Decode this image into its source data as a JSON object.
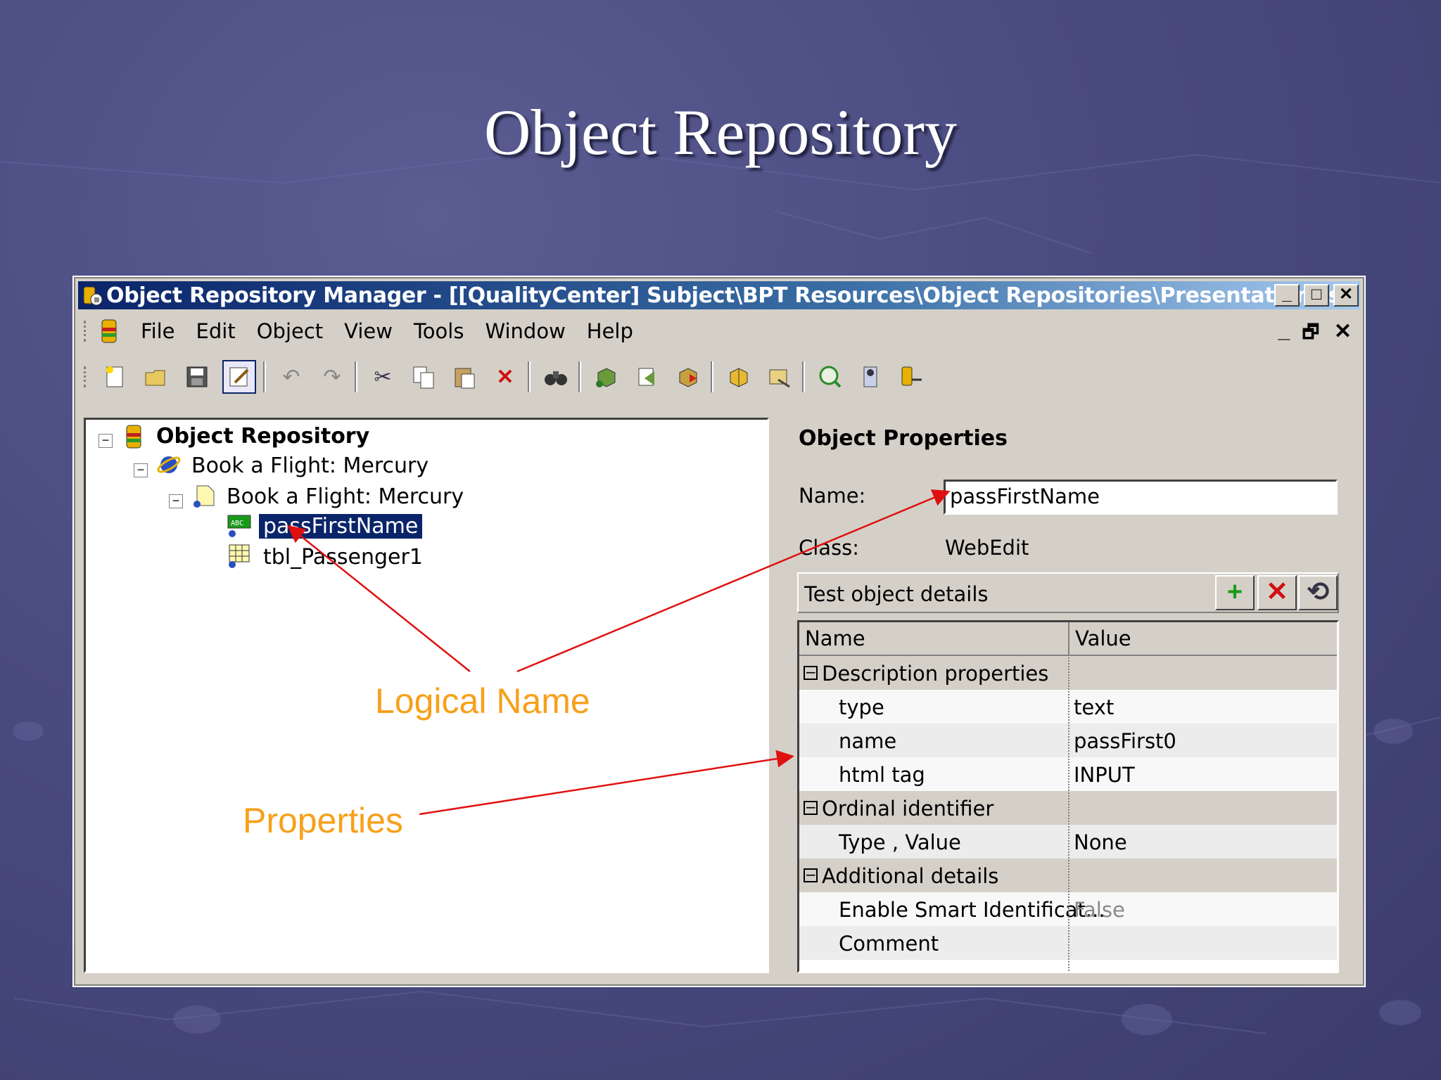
{
  "slide": {
    "title": "Object Repository"
  },
  "window": {
    "title": "Object Repository Manager - [[QualityCenter] Subject\\BPT Resources\\Object Repositories\\Presentation.tsr]",
    "buttons": {
      "minimize": "_",
      "maximize": "□",
      "close": "✕"
    }
  },
  "menu": {
    "items": [
      "File",
      "Edit",
      "Object",
      "View",
      "Tools",
      "Window",
      "Help"
    ],
    "mdi": {
      "minimize": "_",
      "restore": "🗗",
      "close": "✕"
    }
  },
  "tree": {
    "root": "Object Repository",
    "browser": "Book a Flight: Mercury",
    "page": "Book a Flight: Mercury",
    "selected": "passFirstName",
    "table": "tbl_Passenger1"
  },
  "properties": {
    "title": "Object Properties",
    "name_label": "Name:",
    "name_value": "passFirstName",
    "class_label": "Class:",
    "class_value": "WebEdit",
    "details_label": "Test object details",
    "columns": [
      "Name",
      "Value"
    ],
    "rows": [
      {
        "name": "Description properties",
        "value": "",
        "kind": "category"
      },
      {
        "name": "type",
        "value": "text",
        "kind": "prop"
      },
      {
        "name": "name",
        "value": "passFirst0",
        "kind": "prop"
      },
      {
        "name": "html tag",
        "value": "INPUT",
        "kind": "prop"
      },
      {
        "name": "Ordinal identifier",
        "value": "",
        "kind": "category"
      },
      {
        "name": "Type , Value",
        "value": "None",
        "kind": "prop"
      },
      {
        "name": "Additional details",
        "value": "",
        "kind": "category"
      },
      {
        "name": "Enable Smart Identificat...",
        "value": "False",
        "kind": "prop"
      },
      {
        "name": "Comment",
        "value": "",
        "kind": "prop"
      }
    ]
  },
  "annotations": {
    "logical_name": "Logical Name",
    "properties": "Properties"
  },
  "colors": {
    "annotation": "#f7a01a",
    "arrow": "#e01010",
    "titlebar_start": "#0a246a",
    "titlebar_end": "#a6caf0"
  }
}
